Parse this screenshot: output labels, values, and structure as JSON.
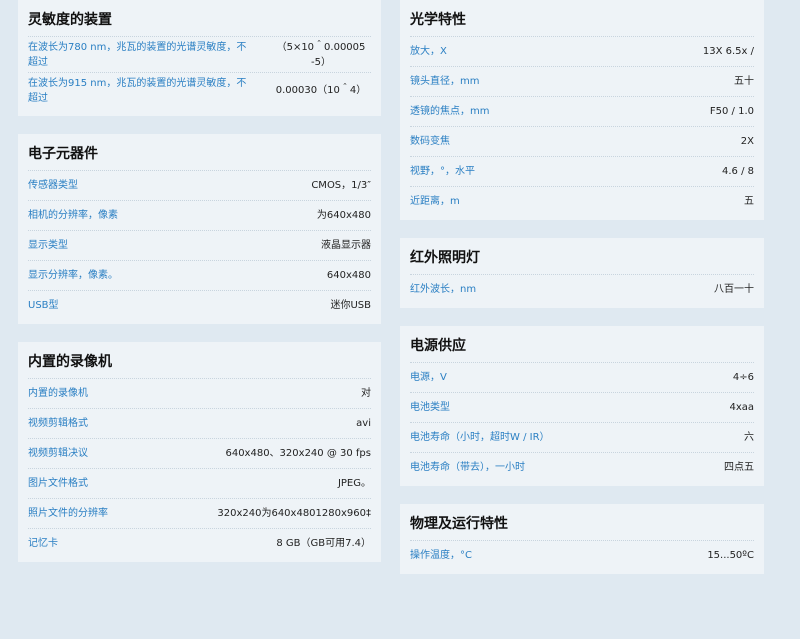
{
  "left": {
    "sensitivity": {
      "title": "灵敏度的装置",
      "rows": [
        {
          "label": "在波长为780 nm，兆瓦的装置的光谱灵敏度，不超过",
          "value": "（5×10＾0.00005 -5）"
        },
        {
          "label": "在波长为915 nm，兆瓦的装置的光谱灵敏度，不超过",
          "value": "0.00030（10＾4）"
        }
      ]
    },
    "electronics": {
      "title": "电子元器件",
      "rows": [
        {
          "label": "传感器类型",
          "value": "CMOS，1/3″"
        },
        {
          "label": "相机的分辨率，像素",
          "value": "为640x480"
        },
        {
          "label": "显示类型",
          "value": "液晶显示器"
        },
        {
          "label": "显示分辨率，像素。",
          "value": "640x480"
        },
        {
          "label": "USB型",
          "value": "迷你USB"
        }
      ]
    },
    "recorder": {
      "title": "内置的录像机",
      "rows": [
        {
          "label": "内置的录像机",
          "value": "对"
        },
        {
          "label": "视频剪辑格式",
          "value": "avi"
        },
        {
          "label": "视频剪辑决议",
          "value": "640x480、320x240 @ 30 fps"
        },
        {
          "label": "图片文件格式",
          "value": "JPEG。"
        },
        {
          "label": "照片文件的分辨率",
          "value": "320x240为640x4801280x960‡"
        },
        {
          "label": "记忆卡",
          "value": "8 GB（GB可用7.4）"
        }
      ]
    }
  },
  "right": {
    "optics": {
      "title": "光学特性",
      "rows": [
        {
          "label": "放大，X",
          "value": "13X 6.5x /"
        },
        {
          "label": "镜头直径，mm",
          "value": "五十"
        },
        {
          "label": "透镜的焦点，mm",
          "value": "F50 / 1.0"
        },
        {
          "label": "数码变焦",
          "value": "2X"
        },
        {
          "label": "视野，°，水平",
          "value": "4.6 / 8"
        },
        {
          "label": "近距离，m",
          "value": "五"
        }
      ]
    },
    "ir": {
      "title": "红外照明灯",
      "rows": [
        {
          "label": "红外波长，nm",
          "value": "八百一十"
        }
      ]
    },
    "power": {
      "title": "电源供应",
      "rows": [
        {
          "label": "电源，V",
          "value": "4÷6"
        },
        {
          "label": "电池类型",
          "value": "4xaa"
        },
        {
          "label": "电池寿命（小时，超时W / IR）",
          "value": "六"
        },
        {
          "label": "电池寿命（带去），一小时",
          "value": "四点五"
        }
      ]
    },
    "physical": {
      "title": "物理及运行特性",
      "rows": [
        {
          "label": "操作温度，°C",
          "value": "15...50ºC"
        }
      ]
    }
  }
}
